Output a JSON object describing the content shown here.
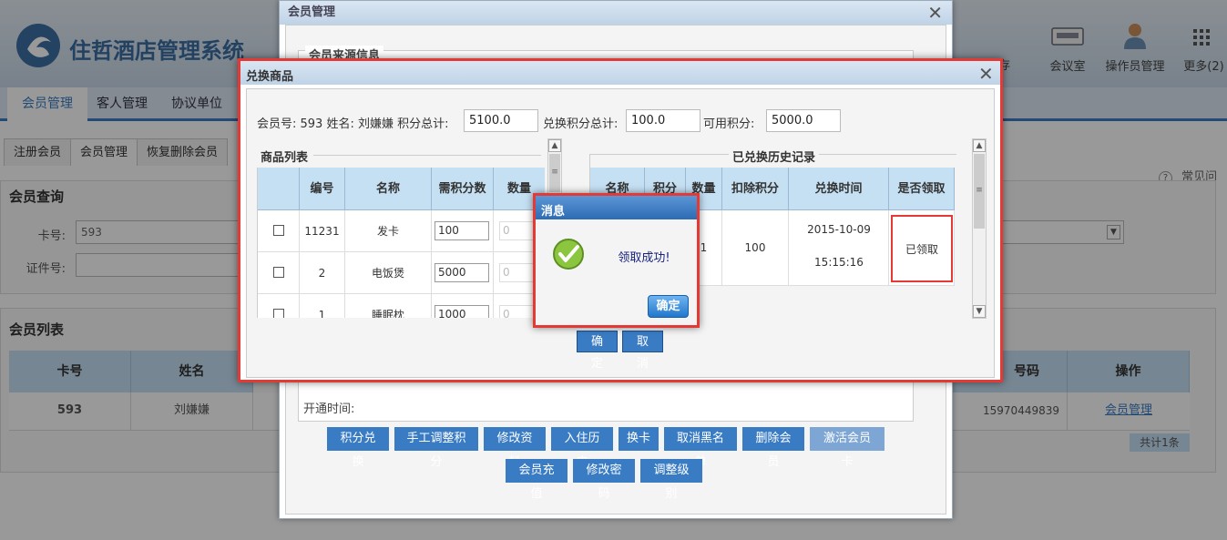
{
  "app": {
    "title": "住哲酒店管理系统",
    "top_icons": [
      {
        "label": "会议室",
        "icon": "meeting-room-icon"
      },
      {
        "label": "操作员管理",
        "icon": "operator-icon"
      },
      {
        "label": "更多(2)",
        "icon": "more-grid-icon"
      }
    ],
    "top_icon_partial": "存",
    "help": "常见问题"
  },
  "nav_tabs": [
    "会员管理",
    "客人管理",
    "协议单位"
  ],
  "sub_tabs": [
    "注册会员",
    "会员管理",
    "恢复删除会员"
  ],
  "member_query": {
    "title": "会员查询",
    "card_label": "卡号:",
    "card_value": "593",
    "cert_label": "证件号:"
  },
  "member_list": {
    "title": "会员列表",
    "headers": [
      "卡号",
      "姓名",
      "号码",
      "操作"
    ],
    "row": {
      "card": "593",
      "name": "刘嫌嫌",
      "phone": "15970449839",
      "action": "会员管理"
    },
    "total": "共计1条"
  },
  "member_window": {
    "title": "会员管理",
    "section": "会员来源信息",
    "open_time_label": "开通时间:",
    "buttons_row1": [
      "积分兑换",
      "手工调整积分",
      "修改资料",
      "入住历史",
      "换卡",
      "取消黑名单",
      "删除会员",
      "激活会员卡"
    ],
    "buttons_row2": [
      "会员充值",
      "修改密码",
      "调整级别"
    ]
  },
  "exchange_dialog": {
    "title": "兑换商品",
    "info": "会员号: 593 姓名: 刘嫌嫌 积分总计:",
    "total_points": "5100.0",
    "exchange_label": "兑换积分总计:",
    "exchange_points": "100.0",
    "available_label": "可用积分:",
    "available_points": "5000.0",
    "goods": {
      "title": "商品列表",
      "headers": [
        "编号",
        "名称",
        "需积分数",
        "数量"
      ],
      "rows": [
        {
          "id": "11231",
          "name": "发卡",
          "points": "100",
          "qty": "0"
        },
        {
          "id": "2",
          "name": "电饭煲",
          "points": "5000",
          "qty": "0"
        },
        {
          "id": "1",
          "name": "睡眠枕",
          "points": "1000",
          "qty": "0"
        }
      ]
    },
    "history": {
      "title": "已兑换历史记录",
      "headers": [
        "名称",
        "积分",
        "数量",
        "扣除积分",
        "兑换时间",
        "是否领取"
      ],
      "row": {
        "qty": "1",
        "deduct": "100",
        "date": "2015-10-09",
        "time": "15:15:16",
        "received": "已领取"
      }
    },
    "ok": "确定",
    "cancel": "取消"
  },
  "message_box": {
    "title": "消息",
    "text": "领取成功!",
    "ok": "确定"
  },
  "colors": {
    "accent": "#3a7cc4",
    "header": "#c5dff3",
    "highlight": "#e53935"
  }
}
